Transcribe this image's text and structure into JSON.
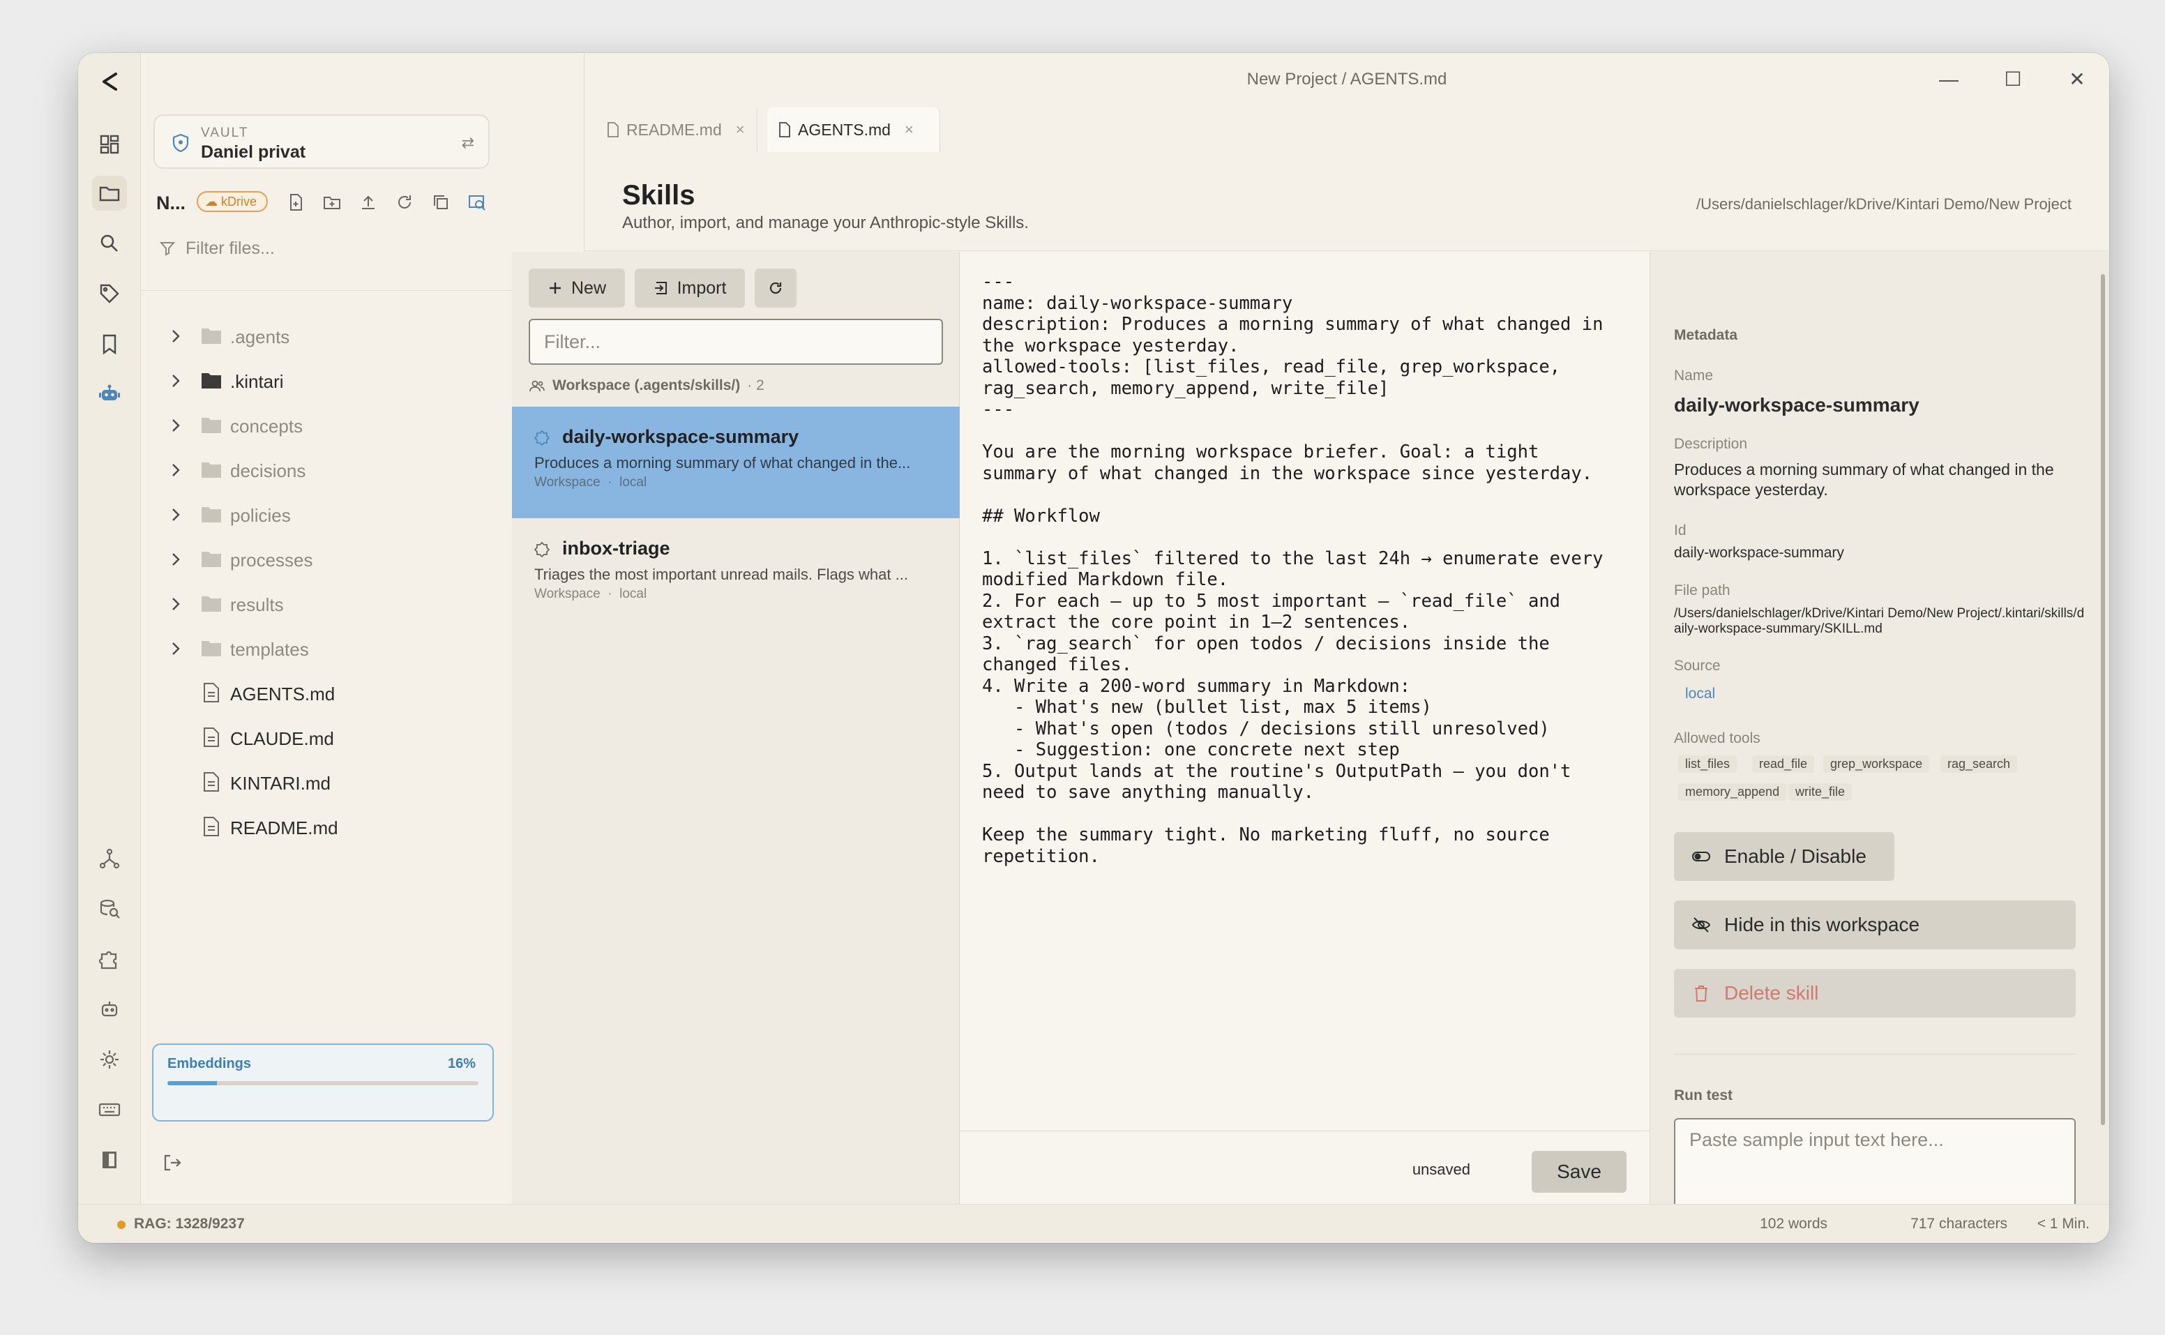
{
  "window": {
    "title": "New Project / AGENTS.md",
    "minimize": "—",
    "maximize": "☐",
    "close": "✕"
  },
  "rail": {
    "logo": "<",
    "icons": [
      "dashboard-icon",
      "folder-icon",
      "search-icon",
      "tag-icon",
      "bookmark-icon",
      "robot-icon",
      "graph-icon",
      "database-search-icon",
      "puzzle-icon",
      "bot-icon",
      "gear-icon",
      "keyboard-icon",
      "panel-icon"
    ]
  },
  "sidebar": {
    "vault_caption": "VAULT",
    "vault_name": "Daniel privat",
    "vault_switch": "⇄",
    "project_short": "N...",
    "cloud_badge": "kDrive",
    "filter_placeholder": "Filter files...",
    "folders": [
      {
        "label": ".agents",
        "dark": false
      },
      {
        "label": ".kintari",
        "dark": true
      },
      {
        "label": "concepts",
        "dark": false
      },
      {
        "label": "decisions",
        "dark": false
      },
      {
        "label": "policies",
        "dark": false
      },
      {
        "label": "processes",
        "dark": false
      },
      {
        "label": "results",
        "dark": false
      },
      {
        "label": "templates",
        "dark": false
      }
    ],
    "files": [
      "AGENTS.md",
      "CLAUDE.md",
      "KINTARI.md",
      "README.md"
    ],
    "embeddings": {
      "label": "Embeddings",
      "percent_text": "16%",
      "progress": 0.16
    }
  },
  "tabs": [
    {
      "label": "README.md",
      "active": false
    },
    {
      "label": "AGENTS.md",
      "active": true
    }
  ],
  "tab_close": "×",
  "header": {
    "title": "Skills",
    "subtitle": "Author, import, and manage your Anthropic-style Skills.",
    "path": "/Users/danielschlager/kDrive/Kintari Demo/New Project"
  },
  "list": {
    "new_label": "New",
    "import_label": "Import",
    "filter_placeholder": "Filter...",
    "group_label": "Workspace (.agents/skills/)",
    "group_count": "· 2",
    "skills": [
      {
        "name": "daily-workspace-summary",
        "desc": "Produces a morning summary of what changed in the...",
        "meta": "Workspace  ·  local",
        "selected": true
      },
      {
        "name": "inbox-triage",
        "desc": "Triages the most important unread mails. Flags what ...",
        "meta": "Workspace  ·  local",
        "selected": false
      }
    ]
  },
  "editor": {
    "content": "---\nname: daily-workspace-summary\ndescription: Produces a morning summary of what changed in\nthe workspace yesterday.\nallowed-tools: [list_files, read_file, grep_workspace,\nrag_search, memory_append, write_file]\n---\n\nYou are the morning workspace briefer. Goal: a tight\nsummary of what changed in the workspace since yesterday.\n\n## Workflow\n\n1. `list_files` filtered to the last 24h → enumerate every\nmodified Markdown file.\n2. For each — up to 5 most important — `read_file` and\nextract the core point in 1–2 sentences.\n3. `rag_search` for open todos / decisions inside the\nchanged files.\n4. Write a 200-word summary in Markdown:\n   - What's new (bullet list, max 5 items)\n   - What's open (todos / decisions still unresolved)\n   - Suggestion: one concrete next step\n5. Output lands at the routine's OutputPath — you don't\nneed to save anything manually.\n\nKeep the summary tight. No marketing fluff, no source\nrepetition.",
    "unsaved_label": "unsaved",
    "save_label": "Save"
  },
  "metadata": {
    "section_title": "Metadata",
    "name_label": "Name",
    "name_value": "daily-workspace-summary",
    "desc_label": "Description",
    "desc_value": "Produces a morning summary of what changed in the workspace yesterday.",
    "id_label": "Id",
    "id_value": "daily-workspace-summary",
    "filepath_label": "File path",
    "filepath_value": "/Users/danielschlager/kDrive/Kintari Demo/New Project/.kintari/skills/daily-workspace-summary/SKILL.md",
    "source_label": "Source",
    "source_value": "local",
    "tools_label": "Allowed tools",
    "tools": [
      "list_files",
      "read_file",
      "grep_workspace",
      "rag_search",
      "memory_append",
      "write_file"
    ],
    "enable_label": "Enable / Disable",
    "hide_label": "Hide in this workspace",
    "delete_label": "Delete skill",
    "run_test_label": "Run test",
    "run_test_placeholder": "Paste sample input text here..."
  },
  "status": {
    "rag": "RAG: 1328/9237",
    "words": "102 words",
    "chars": "717 characters",
    "reading": "< 1 Min."
  },
  "colors": {
    "accent_blue": "#89b6e0",
    "kdrive_orange": "#e0a05a",
    "danger": "#d07a6e",
    "rag_dot": "#e29b22"
  }
}
